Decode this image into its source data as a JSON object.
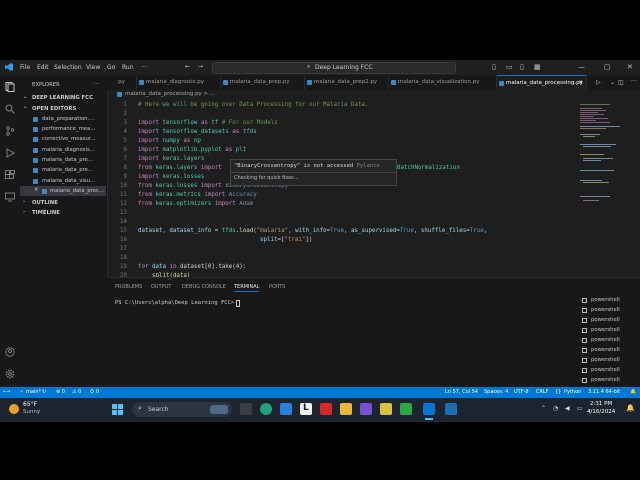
{
  "menu": [
    "File",
    "Edit",
    "Selection",
    "View",
    "Go",
    "Run"
  ],
  "menu_more": "···",
  "command_center": "Deep Learning FCC",
  "explorer": {
    "title": "EXPLORER",
    "more": "···",
    "workspace": "DEEP LEARNING FCC",
    "open_editors": "OPEN EDITORS",
    "files": [
      "data_preparation....",
      "performance_mea...",
      "corrective_measur...",
      "malaria_diagnosis...",
      "malaria_data_pre...",
      "malaria_data_pre...",
      "malaria_data_visu...",
      "malaria_data_proc..."
    ],
    "outline": "OUTLINE",
    "timeline": "TIMELINE"
  },
  "tabs": [
    "py",
    "malaria_diagnosis.py",
    "malaria_data_prep.py",
    "malaria_data_prep2.py",
    "malaria_data_visualization.py",
    "malaria_data_processing.py"
  ],
  "breadcrumb": "malaria_data_processing.py > ...",
  "line_numbers": [
    "1",
    "2",
    "3",
    "4",
    "5",
    "6",
    "7",
    "8",
    "9",
    "10",
    "11",
    "12",
    "13",
    "14",
    "15",
    "16",
    "17",
    "18",
    "19",
    "20"
  ],
  "code": {
    "l1": "# Here we will be going over Data Processing for our Malaria Data.",
    "l3": [
      "import",
      " ",
      "tensorflow",
      " ",
      "as",
      " ",
      "tf",
      " # For our Models"
    ],
    "l4": [
      "import",
      " ",
      "tensorflow_datasets",
      " ",
      "as",
      " ",
      "tfds"
    ],
    "l5": [
      "import",
      " ",
      "numpy",
      " ",
      "as",
      " ",
      "np"
    ],
    "l6": [
      "import",
      " ",
      "matplotlib.pyplot",
      " ",
      "as",
      " ",
      "plt"
    ],
    "l7": [
      "import",
      " ",
      "keras.layers"
    ],
    "l8": [
      "from",
      " ",
      "keras.layers",
      " ",
      "import"
    ],
    "l8_tail": "BatchNormalization",
    "l9": [
      "import",
      " ",
      "keras.losses"
    ],
    "l10": [
      "from",
      " ",
      "keras.losses",
      " ",
      "import",
      " ",
      "BinaryCrossentropy"
    ],
    "l11": [
      "from",
      " ",
      "keras.metrics",
      " ",
      "import",
      " ",
      "Accuracy"
    ],
    "l12": [
      "from",
      " ",
      "keras.optimizers",
      " ",
      "import",
      " ",
      "Adam"
    ],
    "l15_a": "dataset",
    "l15_b": ", ",
    "l15_c": "dataset_info",
    "l15_d": " = ",
    "l15_e": "tfds",
    "l15_f": ".",
    "l15_g": "load",
    "l15_h": "(",
    "l15_i": "\"malaria\"",
    "l15_j": ", ",
    "l15_k": "with_info",
    "l15_l": "=",
    "l15_m": "True",
    "l15_n": ", ",
    "l15_o": "as_supervised",
    "l15_p": "=",
    "l15_q": "True",
    "l15_r": ", ",
    "l15_s": "shuffle_files",
    "l15_t": "=",
    "l15_u": "True",
    "l15_v": ",",
    "l16_a": "split",
    "l16_b": "=[",
    "l16_c": "\"trai",
    "l16_d": "\"",
    "l16_e": "])",
    "l19": [
      "for",
      " ",
      "data",
      " ",
      "in",
      " ",
      "dataset[0].take(4):"
    ],
    "l20": "split(data)"
  },
  "hover": {
    "message_a": "\"BinaryCrossentropy\"",
    "message_b": " is not accessed",
    "source": "Pylance",
    "status": "Checking for quick fixes..."
  },
  "panel": {
    "tabs": [
      "PROBLEMS",
      "OUTPUT",
      "DEBUG CONSOLE",
      "TERMINAL",
      "PORTS"
    ],
    "active_tab": "TERMINAL",
    "prompt": "PS C:\\Users\\alpha\\Deep Learning FCC> ",
    "terminals": [
      "powershell",
      "powershell",
      "powershell",
      "powershell",
      "powershell",
      "powershell",
      "powershell",
      "powershell",
      "powershell",
      "powershell",
      "powershell"
    ]
  },
  "status": {
    "branch": "main*",
    "errors": "⊗ 0",
    "warnings": "⚠ 0",
    "ports": "0",
    "cursor": "Ln 57, Col 54",
    "spaces": "Spaces: 4",
    "encoding": "UTF-8",
    "eol": "CRLF",
    "language": "Python",
    "interpreter": "3.11.4 64-bit"
  },
  "taskbar": {
    "temp": "65°F",
    "weather": "Sunny",
    "search": "Search",
    "time": "2:31 PM",
    "date": "4/16/2024"
  },
  "colors": {
    "accent": "#0078d4",
    "editor_bg": "#1e1e1e",
    "sidebar_bg": "#181818"
  }
}
